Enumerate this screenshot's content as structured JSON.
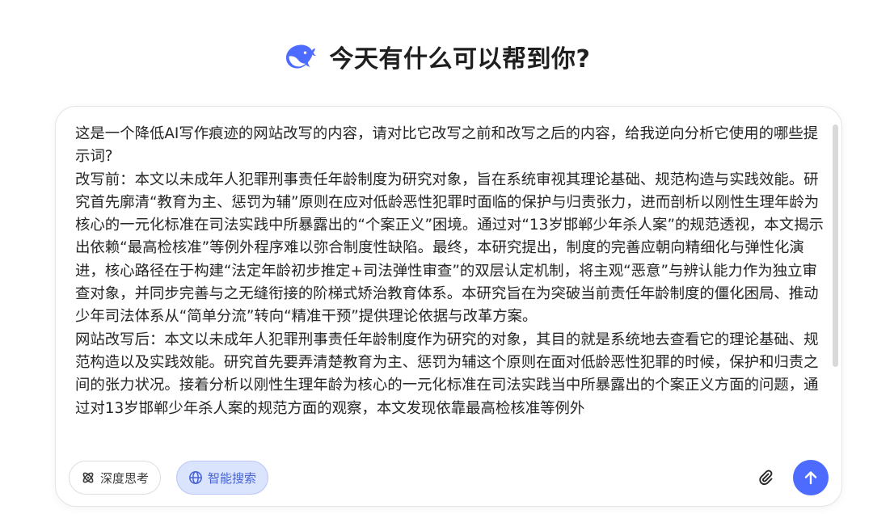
{
  "header": {
    "logo_icon": "whale-logo-icon",
    "title": "今天有什么可以帮到你?",
    "accent_color": "#4d6bfe"
  },
  "composer": {
    "message": "这是一个降低AI写作痕迹的网站改写的内容，请对比它改写之前和改写之后的内容，给我逆向分析它使用的哪些提示词?\n改写前：本文以未成年人犯罪刑事责任年龄制度为研究对象，旨在系统审视其理论基础、规范构造与实践效能。研究首先廓清“教育为主、惩罚为辅”原则在应对低龄恶性犯罪时面临的保护与归责张力，进而剖析以刚性生理年龄为核心的一元化标准在司法实践中所暴露出的“个案正义”困境。通过对“13岁邯郸少年杀人案”的规范透视，本文揭示出依赖“最高检核准”等例外程序难以弥合制度性缺陷。最终，本研究提出，制度的完善应朝向精细化与弹性化演进，核心路径在于构建“法定年龄初步推定+司法弹性审查”的双层认定机制，将主观“恶意”与辨认能力作为独立审查对象，并同步完善与之无缝衔接的阶梯式矫治教育体系。本研究旨在为突破当前责任年龄制度的僵化困局、推动少年司法体系从“简单分流”转向“精准干预”提供理论依据与改革方案。\n网站改写后：本文以未成年人犯罪刑事责任年龄制度作为研究的对象，其目的就是系统地去查看它的理论基础、规范构造以及实践效能。研究首先要弄清楚教育为主、惩罚为辅这个原则在面对低龄恶性犯罪的时候，保护和归责之间的张力状况。接着分析以刚性生理年龄为核心的一元化标准在司法实践当中所暴露出的个案正义方面的问题，通过对13岁邯郸少年杀人案的规范方面的观察，本文发现依靠最高检核准等例外",
    "buttons": {
      "deep_think": {
        "label": "深度思考",
        "icon": "deep-think-icon"
      },
      "web_search": {
        "label": "智能搜索",
        "icon": "globe-icon",
        "active": true
      },
      "attach": {
        "icon": "paperclip-icon"
      },
      "send": {
        "icon": "arrow-up-icon"
      }
    }
  }
}
